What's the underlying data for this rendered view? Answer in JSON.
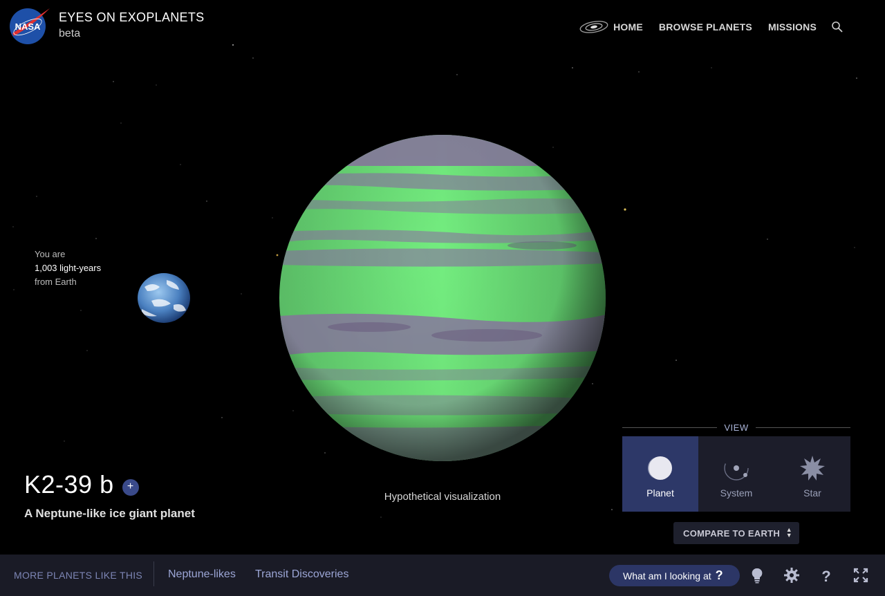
{
  "header": {
    "logo_text": "NASA",
    "title": "EYES ON EXOPLANETS",
    "subtitle": "beta",
    "nav": [
      {
        "label": "HOME",
        "icon": "galaxy-icon"
      },
      {
        "label": "BROWSE PLANETS"
      },
      {
        "label": "MISSIONS"
      }
    ],
    "search_icon": "search-icon"
  },
  "distance": {
    "line1": "You are",
    "line2": "1,003 light-years",
    "line3": "from Earth"
  },
  "planet": {
    "name": "K2-39 b",
    "add_label": "+",
    "description": "A Neptune-like ice giant planet",
    "caption": "Hypothetical visualization"
  },
  "view": {
    "label": "VIEW",
    "options": [
      {
        "label": "Planet",
        "icon": "planet-icon",
        "active": true
      },
      {
        "label": "System",
        "icon": "system-icon",
        "active": false
      },
      {
        "label": "Star",
        "icon": "star-icon",
        "active": false
      }
    ],
    "compare_label": "COMPARE TO EARTH"
  },
  "footer": {
    "more_label": "MORE PLANETS LIKE THIS",
    "links": [
      "Neptune-likes",
      "Transit Discoveries"
    ],
    "what_label": "What am I looking at",
    "icons": [
      "lightbulb-icon",
      "settings-icon",
      "help-icon",
      "fullscreen-icon"
    ]
  },
  "colors": {
    "background": "#000000",
    "footer_bg": "#1a1b26",
    "accent": "#2d3868",
    "planet_green": "#6ee87a",
    "planet_purple": "#7a6590"
  }
}
